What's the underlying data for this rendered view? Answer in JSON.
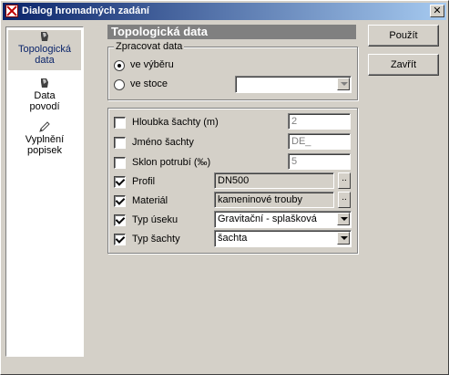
{
  "window": {
    "title": "Dialog hromadných zadání",
    "close_glyph": "✕"
  },
  "sidebar": {
    "items": [
      {
        "label_line1": "Topologická",
        "label_line2": "data",
        "icon": "pen-icon",
        "active": true
      },
      {
        "label_line1": "Data",
        "label_line2": "povodí",
        "icon": "pen-icon",
        "active": false
      },
      {
        "label_line1": "Vyplnění",
        "label_line2": "popisek",
        "icon": "pencil-icon",
        "active": false
      }
    ]
  },
  "header": {
    "title": "Topologická data"
  },
  "process_group": {
    "legend": "Zpracovat data",
    "option_selection": "ve výběru",
    "option_network": "ve stoce",
    "network_value": ""
  },
  "fields": {
    "depth": {
      "label": "Hloubka šachty (m)",
      "value": "2",
      "checked": false
    },
    "name": {
      "label": "Jméno šachty",
      "value": "DE_",
      "checked": false
    },
    "slope": {
      "label": "Sklon potrubí (‰)",
      "value": "5",
      "checked": false
    },
    "profile": {
      "label": "Profil",
      "value": "DN500",
      "checked": true,
      "ellipsis": ".."
    },
    "material": {
      "label": "Materiál",
      "value": "kameninové trouby",
      "checked": true,
      "ellipsis": ".."
    },
    "segment_type": {
      "label": "Typ úseku",
      "value": "Gravitační - splašková",
      "checked": true
    },
    "manhole_type": {
      "label": "Typ šachty",
      "value": "šachta",
      "checked": true
    }
  },
  "buttons": {
    "apply": "Použít",
    "close": "Zavřít"
  }
}
